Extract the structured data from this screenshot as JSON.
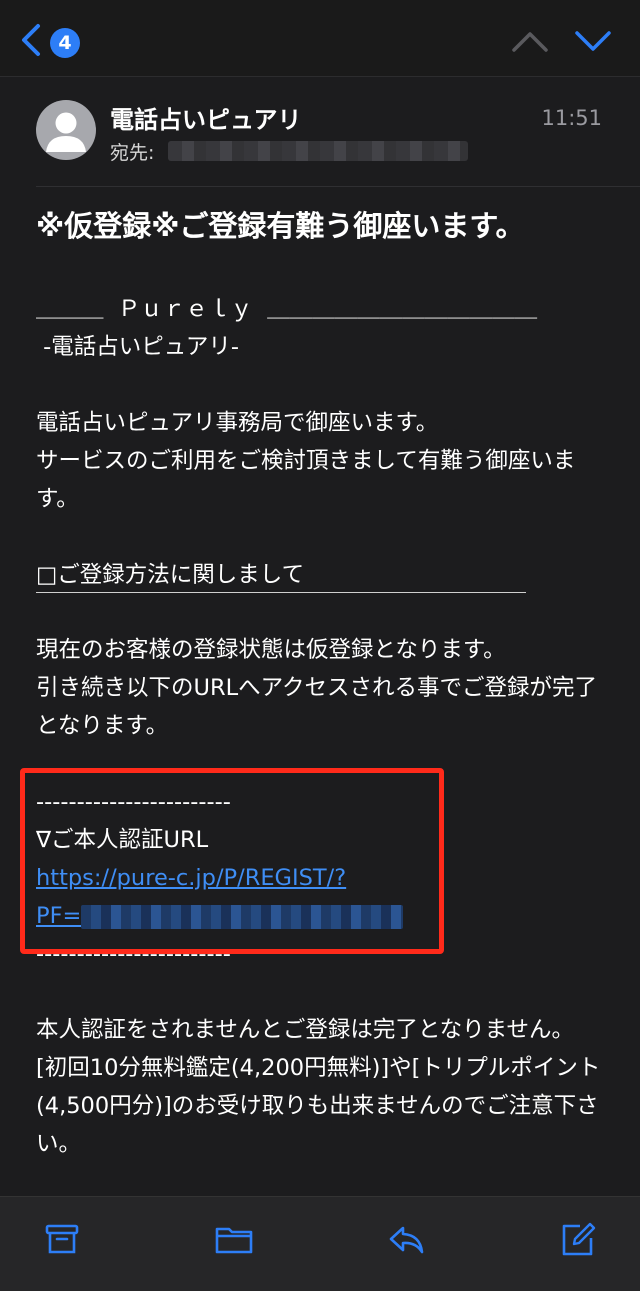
{
  "nav": {
    "back_badge": "4"
  },
  "header": {
    "sender": "電話占いピュアリ",
    "to_label": "宛先:",
    "time": "11:51"
  },
  "subject": "※仮登録※ご登録有難う御座います。",
  "body": {
    "banner_line1": "＿＿＿  Ｐｕｒｅｌｙ  ＿＿＿＿＿＿＿＿＿＿＿＿",
    "banner_line2": " -電話占いピュアリ-",
    "intro_line1": "電話占いピュアリ事務局で御座います。",
    "intro_line2": "サービスのご利用をご検討頂きまして有難う御座います。",
    "section_heading": "□ご登録方法に関しまして",
    "status_line1": "現在のお客様の登録状態は仮登録となります。",
    "status_line2": "引き続き以下のURLへアクセスされる事でご登録が完了となります。",
    "dash_top": "------------------------",
    "auth_label": "∇ご本人認証URL",
    "auth_url_line1": "https://pure-c.jp/P/REGIST/?",
    "auth_url_prefix": "PF=",
    "dash_bottom": "------------------------",
    "warning_line1": "本人認証をされませんとご登録は完了となりません。",
    "warning_line2": "[初回10分無料鑑定(4,200円無料)]や[トリプルポイント(4,500円分)]のお受け取りも出来ませんのでご注意下さい。"
  },
  "colors": {
    "accent": "#2d7ef7",
    "link": "#3f8ef5",
    "highlight": "#ff2a1a",
    "background": "#1c1c1e"
  },
  "toolbar": {
    "icons": [
      "archive-icon",
      "folder-icon",
      "reply-icon",
      "compose-icon"
    ]
  }
}
